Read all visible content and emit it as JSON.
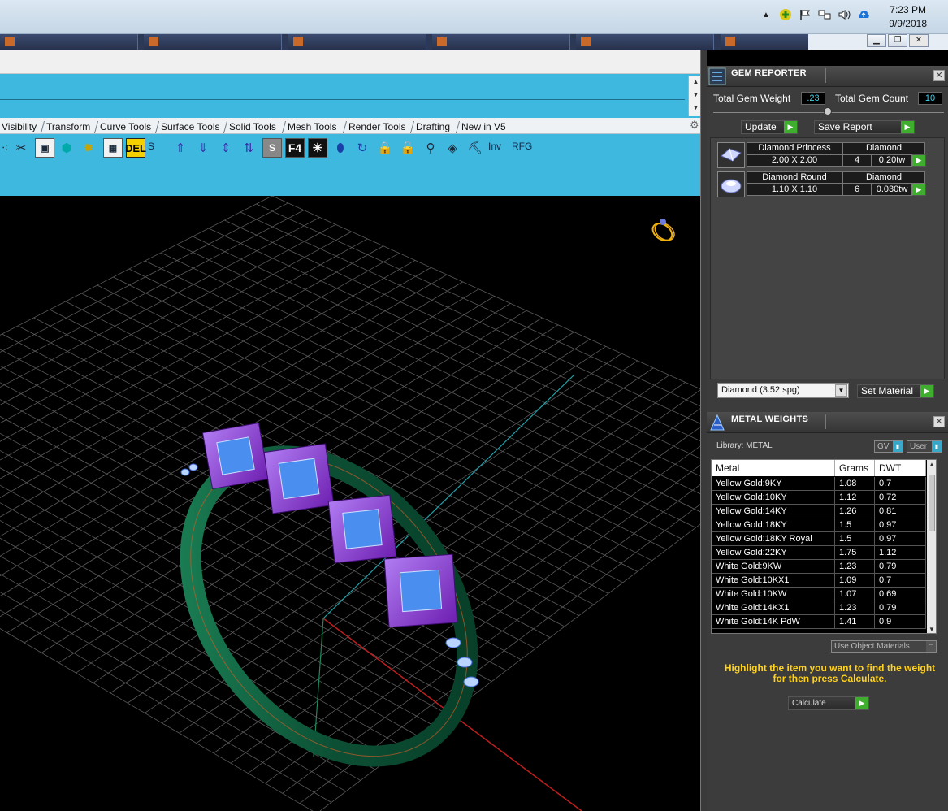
{
  "system_tray": {
    "time": "7:23 PM",
    "date": "9/9/2018",
    "icons": [
      "chevron-up-icon",
      "plus-circle-icon",
      "flag-icon",
      "network-icon",
      "speaker-icon",
      "cloud-upload-icon"
    ]
  },
  "taskbar": {
    "window_controls": [
      "minimize",
      "restore",
      "close"
    ]
  },
  "tabs": [
    {
      "label": "Visibility"
    },
    {
      "label": "Transform"
    },
    {
      "label": "Curve Tools"
    },
    {
      "label": "Surface Tools"
    },
    {
      "label": "Solid Tools"
    },
    {
      "label": "Mesh Tools"
    },
    {
      "label": "Render Tools"
    },
    {
      "label": "Drafting"
    },
    {
      "label": "New in V5"
    }
  ],
  "toolbar": {
    "tools": [
      "points-icon",
      "trim-icon",
      "save-icon",
      "solid-cube-icon",
      "settings-gear-icon",
      "layout-icon",
      "delete-icon",
      "move-up-icon",
      "move-down-icon",
      "scale-icon",
      "flip-icon",
      "grayscale-icon",
      "f4-icon",
      "star-icon",
      "cylinder-icon",
      "rotate-icon",
      "lock-icon",
      "unlock-icon",
      "align-icon",
      "gem-icon",
      "worker-icon"
    ],
    "delete_text": "DEL",
    "s_label": "S",
    "f4_text": "F4",
    "inv_label": "Inv",
    "rfg_label": "RFG"
  },
  "gem_reporter": {
    "title": "GEM REPORTER",
    "total_weight_label": "Total Gem Weight",
    "total_weight_value": ".23",
    "total_count_label": "Total Gem Count",
    "total_count_value": "10",
    "update_label": "Update",
    "save_report_label": "Save Report",
    "gems": [
      {
        "name": "Diamond Princess",
        "material": "Diamond",
        "size": "2.00 X 2.00",
        "count": "4",
        "weight": "0.20tw"
      },
      {
        "name": "Diamond Round",
        "material": "Diamond",
        "size": "1.10 X 1.10",
        "count": "6",
        "weight": "0.030tw"
      }
    ],
    "material_select": "Diamond     (3.52 spg)",
    "set_material_label": "Set Material"
  },
  "metal_weights": {
    "title": "METAL WEIGHTS",
    "library_label": "Library: METAL",
    "gv_label": "GV",
    "user_label": "User",
    "columns": [
      "Metal",
      "Grams",
      "DWT"
    ],
    "rows": [
      [
        "Yellow Gold:9KY",
        "1.08",
        "0.7"
      ],
      [
        "Yellow Gold:10KY",
        "1.12",
        "0.72"
      ],
      [
        "Yellow Gold:14KY",
        "1.26",
        "0.81"
      ],
      [
        "Yellow Gold:18KY",
        "1.5",
        "0.97"
      ],
      [
        "Yellow Gold:18KY Royal",
        "1.5",
        "0.97"
      ],
      [
        "Yellow Gold:22KY",
        "1.75",
        "1.12"
      ],
      [
        "White Gold:9KW",
        "1.23",
        "0.79"
      ],
      [
        "White Gold:10KX1",
        "1.09",
        "0.7"
      ],
      [
        "White Gold:10KW",
        "1.07",
        "0.69"
      ],
      [
        "White Gold:14KX1",
        "1.23",
        "0.79"
      ],
      [
        "White Gold:14K PdW",
        "1.41",
        "0.9"
      ]
    ],
    "use_object_materials_label": "Use Object Materials",
    "hint": "Highlight the item you want to find the weight for then press Calculate.",
    "calculate_label": "Calculate"
  },
  "colors": {
    "toolbar_blue": "#3fb8e0",
    "panel_gray": "#3c3c3c",
    "accent_green": "#3fae2e",
    "hint_yellow": "#ffd21e",
    "ring_green": "#0d5a3c",
    "gem_purple": "#8b2fc9",
    "gem_blue": "#4a8ff0"
  }
}
